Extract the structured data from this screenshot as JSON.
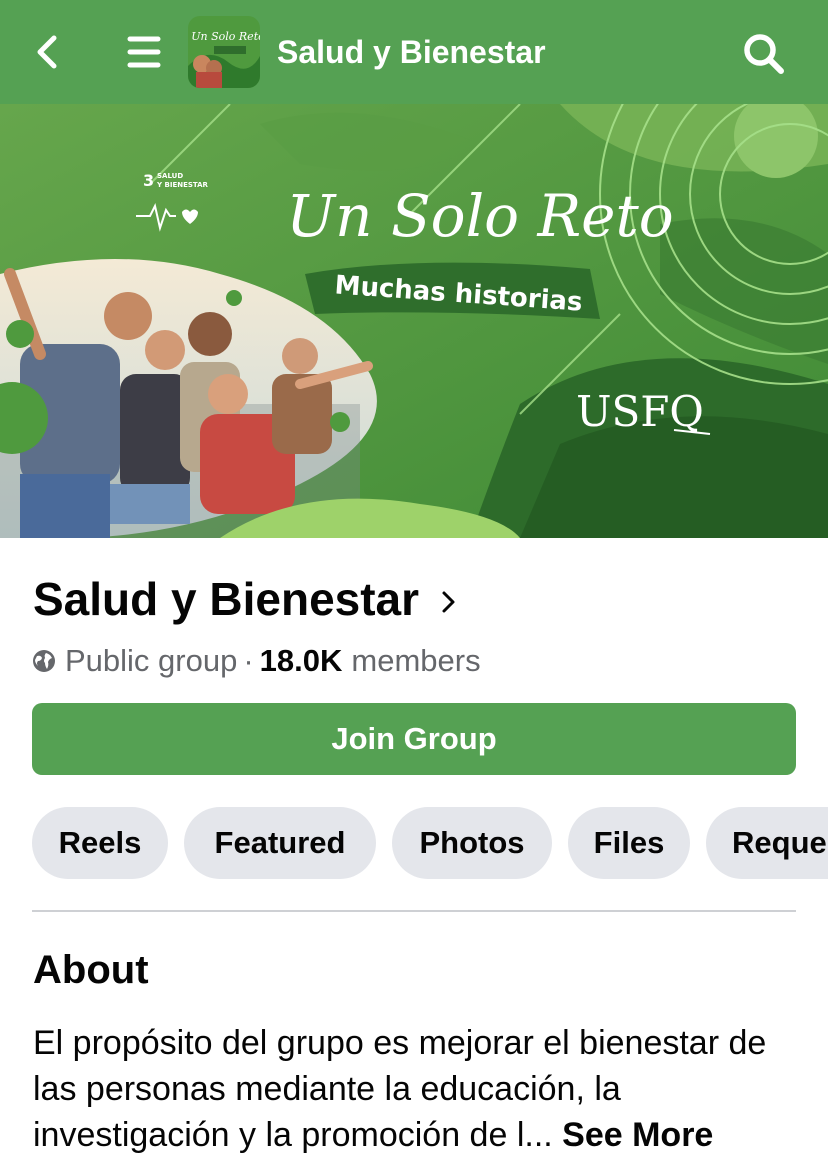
{
  "header": {
    "title": "Salud y Bienestar",
    "back_icon": "chevron-left-icon",
    "menu_icon": "hamburger-menu-icon",
    "search_icon": "search-icon",
    "thumb_text": "Un Solo Reto"
  },
  "cover": {
    "badge_number": "3",
    "badge_line1": "SALUD",
    "badge_line2": "Y BIENESTAR",
    "headline": "Un Solo Reto",
    "subheadline": "Muchas historias",
    "logo_text": "USFQ"
  },
  "group": {
    "name": "Salud y Bienestar",
    "privacy": "Public group",
    "separator": "·",
    "member_count": "18.0K",
    "members_label": "members",
    "join_label": "Join Group"
  },
  "tabs": [
    "Reels",
    "Featured",
    "Photos",
    "Files",
    "Reque"
  ],
  "about": {
    "title": "About",
    "text": "El propósito del grupo es mejorar el bienestar de las personas mediante la educación, la investigación y la promoción de l...",
    "see_more": "See More"
  },
  "colors": {
    "brand_green": "#55a153",
    "chip_bg": "#e4e6eb",
    "secondary_text": "#65676b"
  }
}
